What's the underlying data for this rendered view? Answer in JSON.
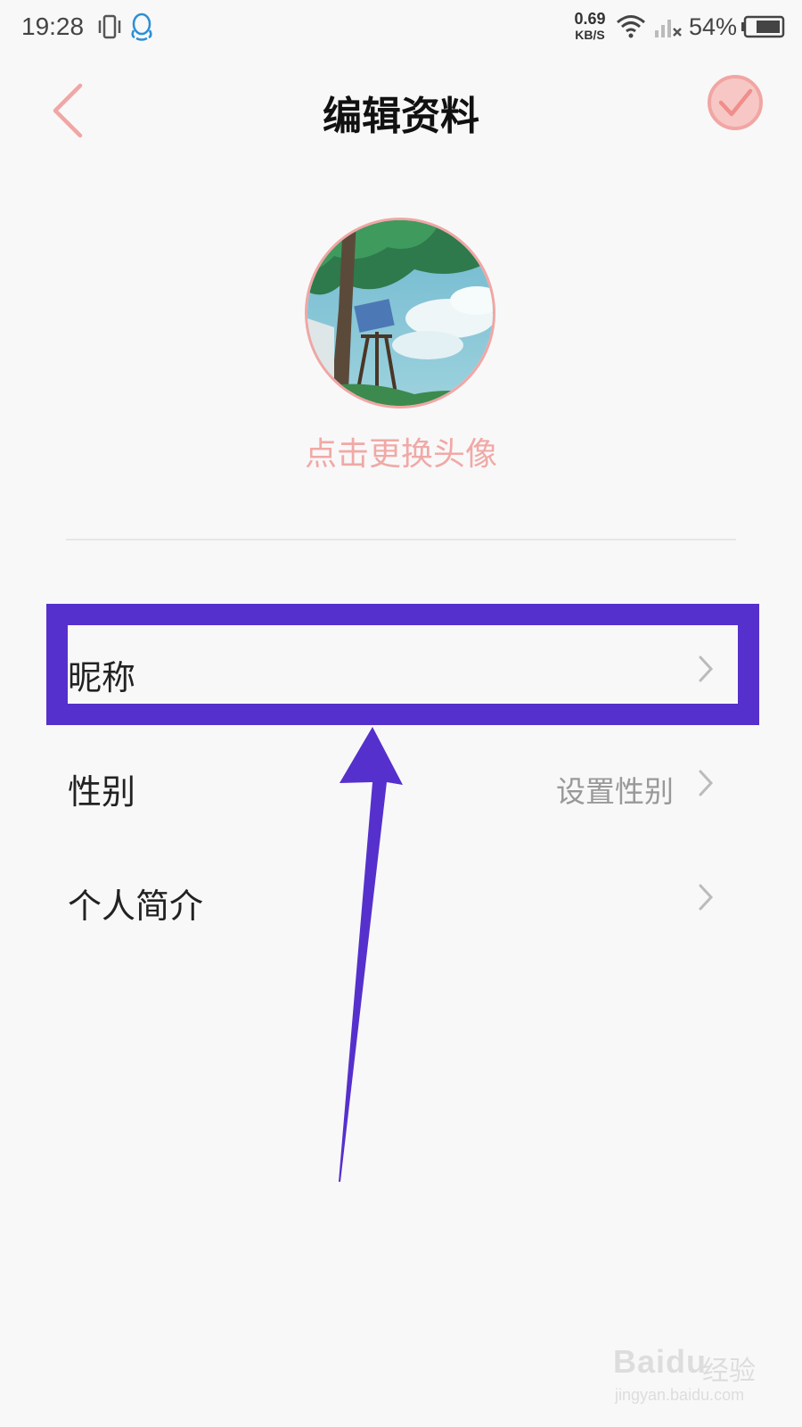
{
  "status_bar": {
    "time": "19:28",
    "net_speed_value": "0.69",
    "net_speed_unit": "KB/S",
    "battery_percent": "54%",
    "icons": [
      "vibrate-icon",
      "qq-icon",
      "wifi-icon",
      "signal-icon",
      "battery-icon"
    ]
  },
  "header": {
    "title": "编辑资料",
    "back_icon": "chevron-left-icon",
    "confirm_icon": "check-circle-icon"
  },
  "avatar": {
    "change_label": "点击更换头像"
  },
  "profile_rows": [
    {
      "label": "昵称",
      "value": ""
    },
    {
      "label": "性别",
      "value": "设置性别"
    },
    {
      "label": "个人简介",
      "value": ""
    }
  ],
  "annotation": {
    "highlight_color": "#5630cc"
  },
  "watermark": {
    "logo": "Baidu",
    "text": "经验",
    "url": "jingyan.baidu.com"
  },
  "colors": {
    "accent": "#f0a9a6",
    "background": "#f8f8f9"
  }
}
